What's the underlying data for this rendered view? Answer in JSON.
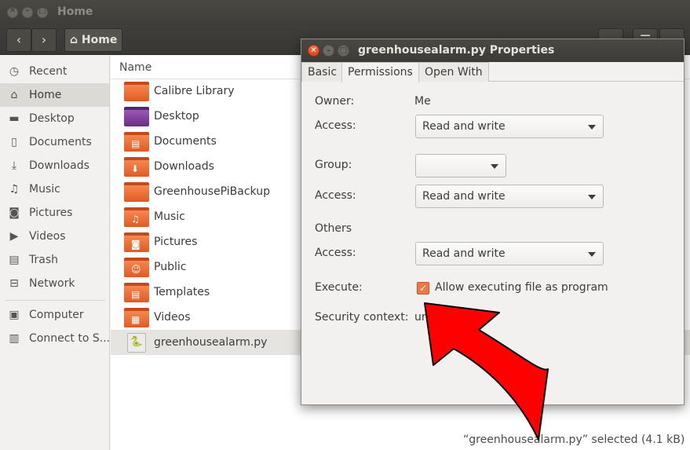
{
  "window": {
    "title": "Home"
  },
  "toolbar": {
    "back_glyph": "‹",
    "forward_glyph": "›",
    "path_label": "Home",
    "search_glyph": "⌕",
    "list_glyph": "☰",
    "menu_glyph": "⋯"
  },
  "sidebar": {
    "items": [
      {
        "label": "Recent",
        "icon": "clock-icon",
        "glyph": "◷"
      },
      {
        "label": "Home",
        "icon": "home-icon",
        "glyph": "⌂"
      },
      {
        "label": "Desktop",
        "icon": "desktop-folder-icon",
        "glyph": "▬"
      },
      {
        "label": "Documents",
        "icon": "document-icon",
        "glyph": "▯"
      },
      {
        "label": "Downloads",
        "icon": "download-icon",
        "glyph": "⤓"
      },
      {
        "label": "Music",
        "icon": "music-icon",
        "glyph": "♫"
      },
      {
        "label": "Pictures",
        "icon": "camera-icon",
        "glyph": "◙"
      },
      {
        "label": "Videos",
        "icon": "video-icon",
        "glyph": "▶"
      },
      {
        "label": "Trash",
        "icon": "trash-icon",
        "glyph": "▤"
      },
      {
        "label": "Network",
        "icon": "network-icon",
        "glyph": "⊟"
      },
      {
        "label": "Computer",
        "icon": "computer-icon",
        "glyph": "▣"
      },
      {
        "label": "Connect to S...",
        "icon": "connect-server-icon",
        "glyph": "▥"
      }
    ]
  },
  "main": {
    "column_header": "Name",
    "files": [
      {
        "name": "Calibre Library",
        "icon": "folder-icon",
        "emblem": ""
      },
      {
        "name": "Desktop",
        "icon": "desktop-folder-icon",
        "emblem": ""
      },
      {
        "name": "Documents",
        "icon": "documents-folder-icon",
        "emblem": "▤"
      },
      {
        "name": "Downloads",
        "icon": "downloads-folder-icon",
        "emblem": "⬇"
      },
      {
        "name": "GreenhousePiBackup",
        "icon": "folder-icon",
        "emblem": ""
      },
      {
        "name": "Music",
        "icon": "music-folder-icon",
        "emblem": "♫"
      },
      {
        "name": "Pictures",
        "icon": "pictures-folder-icon",
        "emblem": "◙"
      },
      {
        "name": "Public",
        "icon": "public-folder-icon",
        "emblem": "☺"
      },
      {
        "name": "Templates",
        "icon": "templates-folder-icon",
        "emblem": "▤"
      },
      {
        "name": "Videos",
        "icon": "videos-folder-icon",
        "emblem": "▦"
      },
      {
        "name": "greenhousealarm.py",
        "icon": "python-file-icon",
        "emblem": ""
      }
    ],
    "status": "“greenhousealarm.py” selected  (4.1 kB)"
  },
  "dialog": {
    "title": "greenhousealarm.py Properties",
    "close_glyph": "✕",
    "min_glyph": "–",
    "max_glyph": "□",
    "tabs": [
      "Basic",
      "Permissions",
      "Open With"
    ],
    "active_tab": "Permissions",
    "owner_label": "Owner:",
    "owner_value": "Me",
    "owner_access_label": "Access:",
    "owner_access": "Read and write",
    "group_label": "Group:",
    "group_value": "",
    "group_access_label": "Access:",
    "group_access": "Read and write",
    "others_label": "Others",
    "others_access_label": "Access:",
    "others_access": "Read and write",
    "execute_label": "Execute:",
    "execute_checkbox_label": "Allow executing file as program",
    "execute_checked": true,
    "check_glyph": "✓",
    "security_label": "Security context:",
    "security_value": "unknown"
  },
  "annotation": {
    "arrow_color": "#ff0000",
    "arrow_stroke": "#000000"
  }
}
